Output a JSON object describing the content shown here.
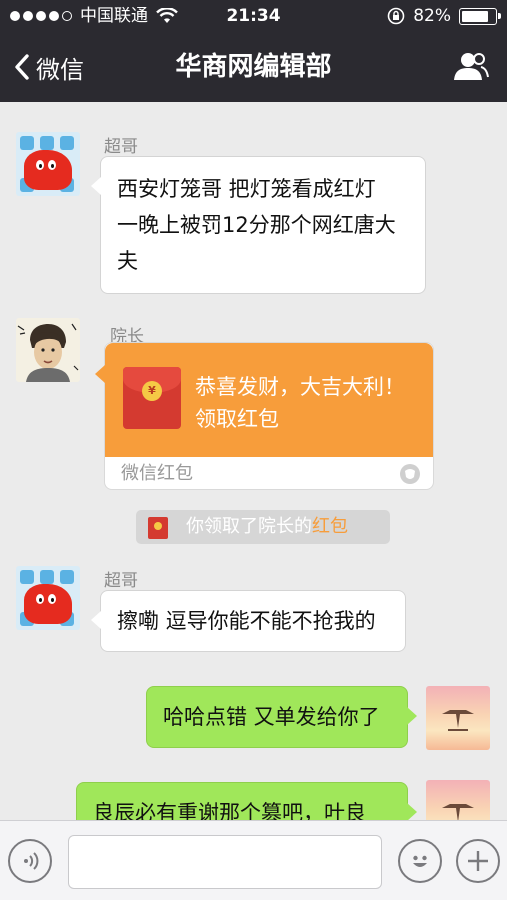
{
  "status_bar": {
    "carrier": "中国联通",
    "time": "21:34",
    "battery_percent": "82%",
    "battery_level": 0.82,
    "signal_dots_filled": 4,
    "signal_dots_total": 5
  },
  "nav": {
    "back_label": "微信",
    "title": "华商网编辑部",
    "person_icon": "person-icon"
  },
  "messages": {
    "m1": {
      "sender": "超哥",
      "text_lines": [
        "西安灯笼哥 把灯笼看成红灯",
        "一晚上被罚12分那个网红唐大",
        "夫"
      ]
    },
    "m2": {
      "sender": "院长",
      "packet_line1": "恭喜发财，大吉大利！",
      "packet_line2": "领取红包",
      "packet_footer": "微信红包",
      "coin": "¥"
    },
    "notice": {
      "prefix": "你领取了院长的",
      "highlight": "红包"
    },
    "m3": {
      "sender": "超哥",
      "text": "擦嘞 逗导你能不能不抢我的"
    },
    "m4": {
      "text": "哈哈点错 又单发给你了"
    },
    "m5": {
      "text": "良辰必有重谢那个篡吧，叶良"
    }
  },
  "colors": {
    "nav_bg": "#2b2a30",
    "chat_bg": "#ebebeb",
    "green_bubble": "#a0e75a",
    "packet_orange": "#f79d3b",
    "packet_red": "#d43a30"
  }
}
